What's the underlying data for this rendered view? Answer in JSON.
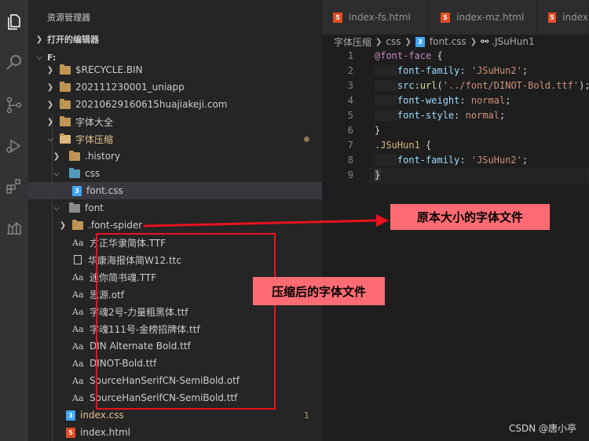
{
  "sidebar": {
    "title": "资源管理器",
    "open_editors": "打开的编辑器",
    "root": "F:",
    "items": [
      {
        "label": "$RECYCLE.BIN"
      },
      {
        "label": "202111230001_uniapp"
      },
      {
        "label": "20210629160615huajiakeji.com"
      },
      {
        "label": "字体大全"
      },
      {
        "label": "字体压缩"
      },
      {
        "label": ".history"
      },
      {
        "label": "css"
      },
      {
        "label": "font.css"
      },
      {
        "label": "font"
      },
      {
        "label": ".font-spider"
      },
      {
        "label": "方正华隶简体.TTF"
      },
      {
        "label": "华康海报体简W12.ttc"
      },
      {
        "label": "迷你简书魂.TTF"
      },
      {
        "label": "思源.otf"
      },
      {
        "label": "字魂2号-力量粗黑体.ttf"
      },
      {
        "label": "字魂111号-金榜招牌体.ttf"
      },
      {
        "label": "DIN Alternate Bold.ttf"
      },
      {
        "label": "DINOT-Bold.ttf"
      },
      {
        "label": "SourceHanSerifCN-SemiBold.otf"
      },
      {
        "label": "SourceHanSerifCN-SemiBold.ttf"
      },
      {
        "label": "index.css",
        "badge": "1"
      },
      {
        "label": "index.html"
      }
    ]
  },
  "tabs": [
    {
      "label": "index-fs.html"
    },
    {
      "label": "index-mz.html"
    },
    {
      "label": "index"
    }
  ],
  "breadcrumb": {
    "parts": [
      "字体压缩",
      "css",
      "font.css",
      ".JSuHun1"
    ]
  },
  "editor": {
    "line_numbers": [
      "1",
      "2",
      "3",
      "4",
      "5",
      "6",
      "7",
      "8",
      "9"
    ]
  },
  "annotations": {
    "original": "原本大小的字体文件",
    "compressed": "压缩后的字体文件",
    "watermark": "CSDN @唐小亭"
  },
  "colors": {
    "accent_red": "#e8131d",
    "callout_bg": "#ff6b72"
  }
}
